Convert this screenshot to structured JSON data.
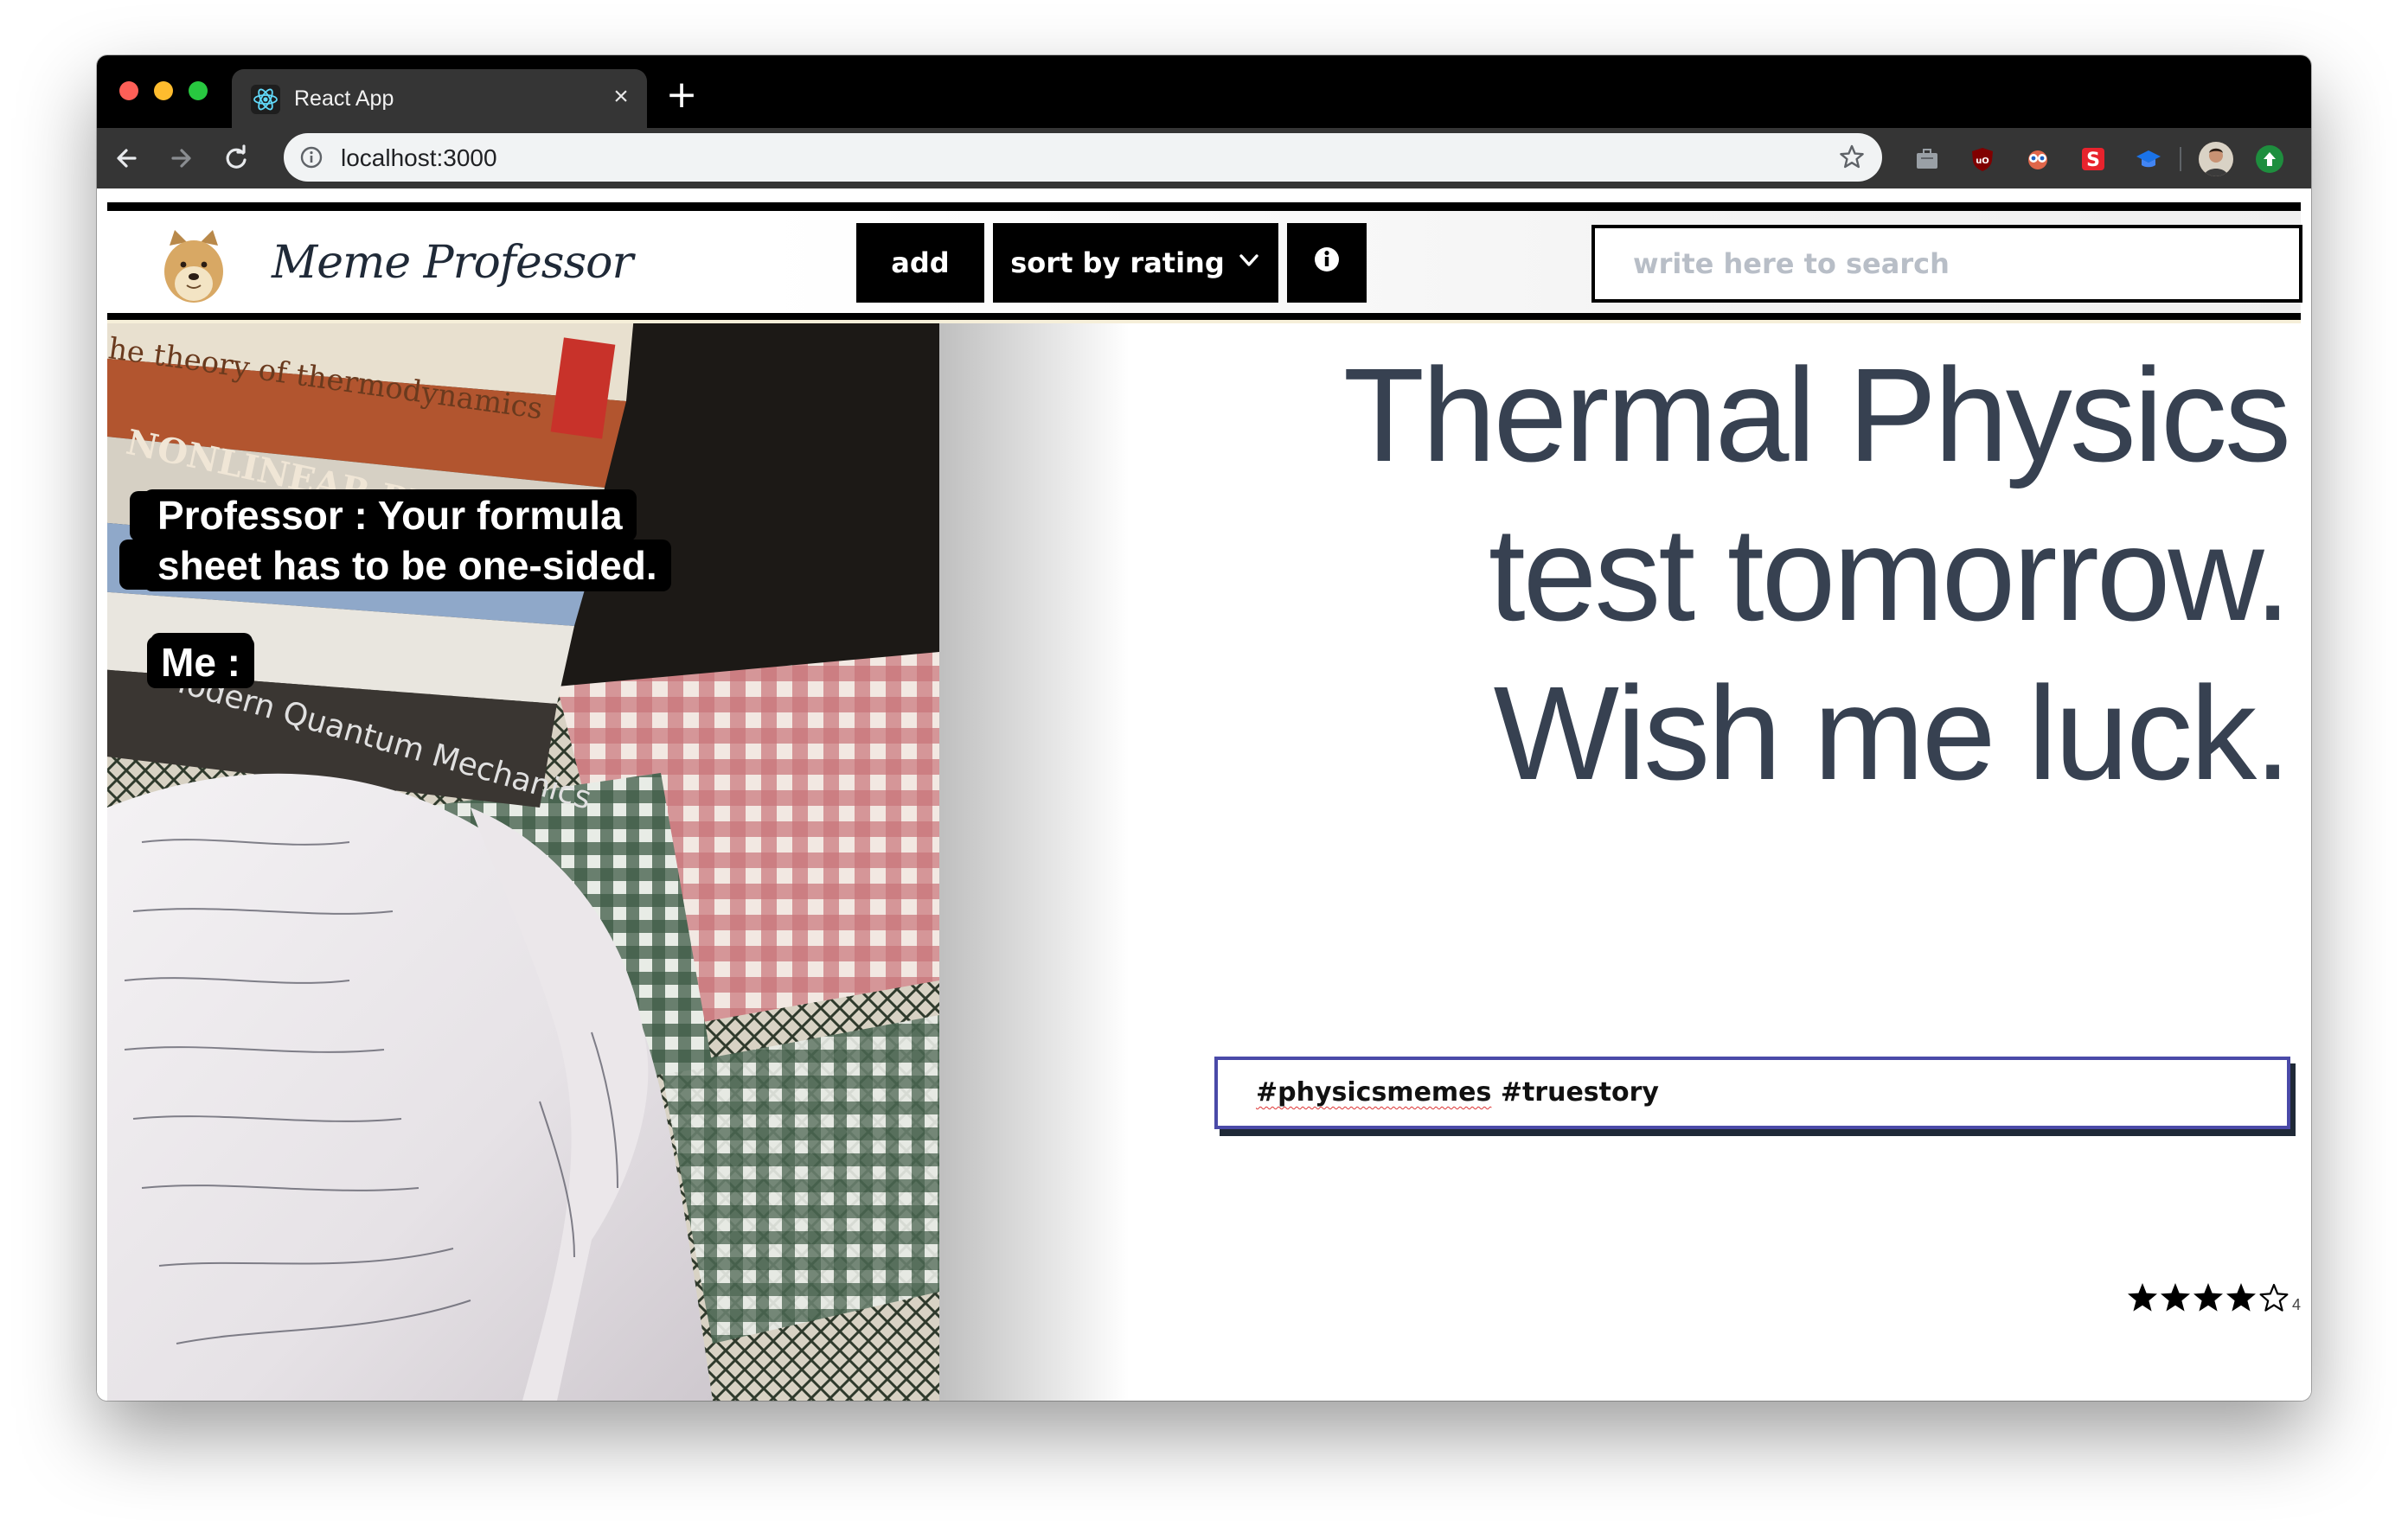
{
  "browser": {
    "tab_title": "React App",
    "url": "localhost:3000",
    "new_tab_symbol": "+",
    "close_symbol": "×",
    "extensions": [
      "briefcase-icon",
      "ublock-icon",
      "owl-icon",
      "s-extension-icon",
      "graduation-cap-icon"
    ]
  },
  "header": {
    "brand": "Meme Professor",
    "add_label": "add",
    "sort_label": "sort by rating",
    "info_symbol": "i",
    "search_placeholder": "write here to search",
    "search_value": ""
  },
  "meme": {
    "image_text": {
      "caption_line1": "Professor : Your formula",
      "caption_line2": "sheet has to be one-sided.",
      "me_label": "Me :"
    },
    "title_lines": [
      "Thermal Physics",
      "test tomorrow.",
      "Wish me luck."
    ],
    "tags_first": "#physicsmemes",
    "tags_rest": " #truestory",
    "rating": 4,
    "rating_max": 5,
    "rating_text": "4"
  },
  "colors": {
    "title": "#374151",
    "tags_border": "#4a4aa8",
    "button_bg": "#000000"
  }
}
